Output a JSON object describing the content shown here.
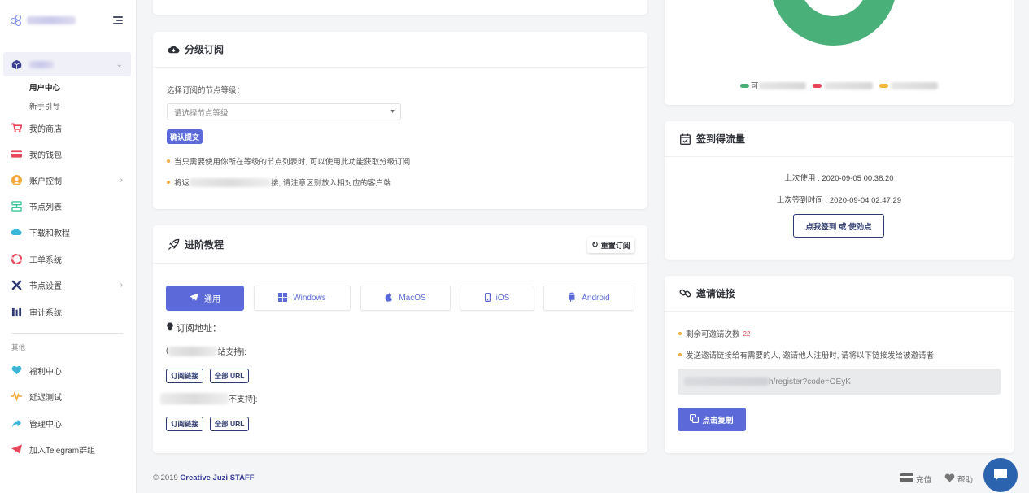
{
  "sidebar": {
    "group_label": "",
    "sub_items": [
      "用户中心",
      "新手引导"
    ],
    "items": [
      {
        "label": "我的商店",
        "icon": "cart-icon",
        "color": "#e8465a"
      },
      {
        "label": "我的钱包",
        "icon": "wallet-icon",
        "color": "#e8465a"
      },
      {
        "label": "账户控制",
        "icon": "user-circle-icon",
        "color": "#f1a93c",
        "chevron": true
      },
      {
        "label": "节点列表",
        "icon": "sitemap-icon",
        "color": "#3fc39a"
      },
      {
        "label": "下载和教程",
        "icon": "cloud-icon",
        "color": "#3ab6d6"
      },
      {
        "label": "工单系统",
        "icon": "lifebuoy-icon",
        "color": "#e8465a"
      },
      {
        "label": "节点设置",
        "icon": "tools-icon",
        "color": "#2e3b70",
        "chevron": true
      },
      {
        "label": "审计系统",
        "icon": "audit-icon",
        "color": "#2e3b70"
      }
    ],
    "section_label": "其他",
    "other_items": [
      {
        "label": "福利中心",
        "icon": "heart-icon",
        "color": "#3ab6d6"
      },
      {
        "label": "延迟测试",
        "icon": "pulse-icon",
        "color": "#f1a93c"
      },
      {
        "label": "管理中心",
        "icon": "share-icon",
        "color": "#3ab6d6"
      },
      {
        "label": "加入Telegram群组",
        "icon": "telegram-icon",
        "color": "#e8465a"
      }
    ]
  },
  "grade_card": {
    "title": "分级订阅",
    "label": "选择订阅的节点等级：",
    "select_placeholder": "请选择节点等级",
    "confirm_label": "确认提交",
    "tip1": "当只需要使用你所在等级的节点列表时, 可以使用此功能获取分级订阅",
    "tip2_pre": "将返",
    "tip2_post": "接, 请注意区别放入相对应的客户端"
  },
  "tutorial_card": {
    "title": "进阶教程",
    "reset_label": "重置订阅",
    "tabs": [
      {
        "label": "通用",
        "icon": "paper-plane-icon"
      },
      {
        "label": "Windows",
        "icon": "windows-icon"
      },
      {
        "label": "MacOS",
        "icon": "apple-icon"
      },
      {
        "label": "iOS",
        "icon": "mobile-icon"
      },
      {
        "label": "Android",
        "icon": "android-icon"
      }
    ],
    "sub_heading": "订阅地址：",
    "line1_pre": "(",
    "line1_post": "站支持]:",
    "line2_post": "不支持]:",
    "btn_sub": "订阅链接",
    "btn_all": "全部 URL"
  },
  "donut": {
    "color": "#4ab07a",
    "legend": [
      {
        "color": "#4ab07a",
        "label": "可"
      },
      {
        "color": "#e8465a",
        "label": ""
      },
      {
        "color": "#f1b93c",
        "label": ""
      }
    ]
  },
  "checkin_card": {
    "title": "签到得流量",
    "last_use": "上次使用 : 2020-09-05 00:38:20",
    "last_checkin": "上次签到时间 : 2020-09-04 02:47:29",
    "button_label": "点我签到 或 使劲点"
  },
  "invite_card": {
    "title": "邀请链接",
    "remaining_label": "剩余可邀请次数",
    "remaining_count": "22",
    "tip": "发送邀请链接给有需要的人, 邀请他人注册时, 请将以下链接发给被邀请者:",
    "link_visible": "h/register?code=OEyK",
    "copy_label": "点击复制"
  },
  "footer": {
    "prefix": "© 2019",
    "brand": "Creative Juzi",
    "suffix": "STAFF",
    "recharge": "充值",
    "help": "帮助"
  }
}
